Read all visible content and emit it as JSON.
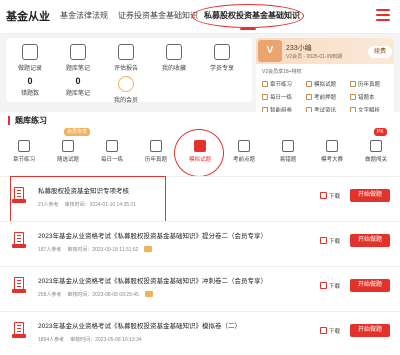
{
  "colors": {
    "accent": "#e3322b",
    "vip_gold": "#f0b35a"
  },
  "topbar": {
    "tabs": [
      {
        "label": "基金从业",
        "icon": "chevron-down-icon"
      },
      {
        "label": "基金法律法规"
      },
      {
        "label": "证券投资基金基础知识"
      },
      {
        "label": "私募股权投资基金基础知识"
      }
    ],
    "menu_icon": "menu-icon"
  },
  "shortcuts": [
    {
      "label": "做题记录",
      "icon": "record-icon"
    },
    {
      "label": "题库笔记",
      "icon": "note-icon"
    },
    {
      "label": "评估报告",
      "icon": "report-icon"
    },
    {
      "label": "我的收藏",
      "icon": "star-icon"
    },
    {
      "label": "学员专享",
      "icon": "user-icon"
    }
  ],
  "stats": [
    {
      "num": "0",
      "label": "错题数"
    },
    {
      "num": "0",
      "label": "题库笔记"
    },
    {
      "label": "我的会员",
      "icon": "vip-icon"
    }
  ],
  "vip": {
    "name": "233小编",
    "date": "V2会员 - 2025-01-09到期",
    "renew": "续费",
    "sub": "V2会员享18+特权",
    "features": [
      "章节练习",
      "模拟试题",
      "历年真题",
      "每日一练",
      "考前押题",
      "错题本",
      "智能组卷",
      "考试资讯",
      "文字解析"
    ]
  },
  "section": {
    "title": "题库练习"
  },
  "categories": [
    {
      "label": "章节练习"
    },
    {
      "label": "随选试题",
      "badge": "会员专享"
    },
    {
      "label": "每日一练"
    },
    {
      "label": "历年真题"
    },
    {
      "label": "模拟试题"
    },
    {
      "label": "考前点题"
    },
    {
      "label": "易错题"
    },
    {
      "label": "模考大赛"
    },
    {
      "label": "做题闯关",
      "badge": "PK"
    }
  ],
  "exams": [
    {
      "title": "私募股权投资基金知识专项考核",
      "participants": "21人参考",
      "time_label": "审核时间：2024-01-10 14:35:21",
      "vip": false,
      "download": "下载",
      "action": "开始做题"
    },
    {
      "title": "2023年基金从业资格考试《私募股权投资基金基础知识》提分卷二（会员专享）",
      "participants": "187人参考",
      "time_label": "审核时间：2023-09-18 11:31:52",
      "vip": true,
      "download": "下载",
      "action": "开始做题"
    },
    {
      "title": "2023年基金从业资格考试《私募股权投资基金基础知识》冲刺卷二（会员专享）",
      "participants": "258人参考",
      "time_label": "审核时间：2023-08-08 09:29:45",
      "vip": true,
      "download": "下载",
      "action": "开始做题"
    },
    {
      "title": "2023年基金从业资格考试《私募股权投资基金基础知识》模拟卷（二）",
      "participants": "1894人参考",
      "time_label": "审核时间：2023-05-08 10:13:34",
      "vip": false,
      "download": "下载",
      "action": "开始做题"
    }
  ]
}
